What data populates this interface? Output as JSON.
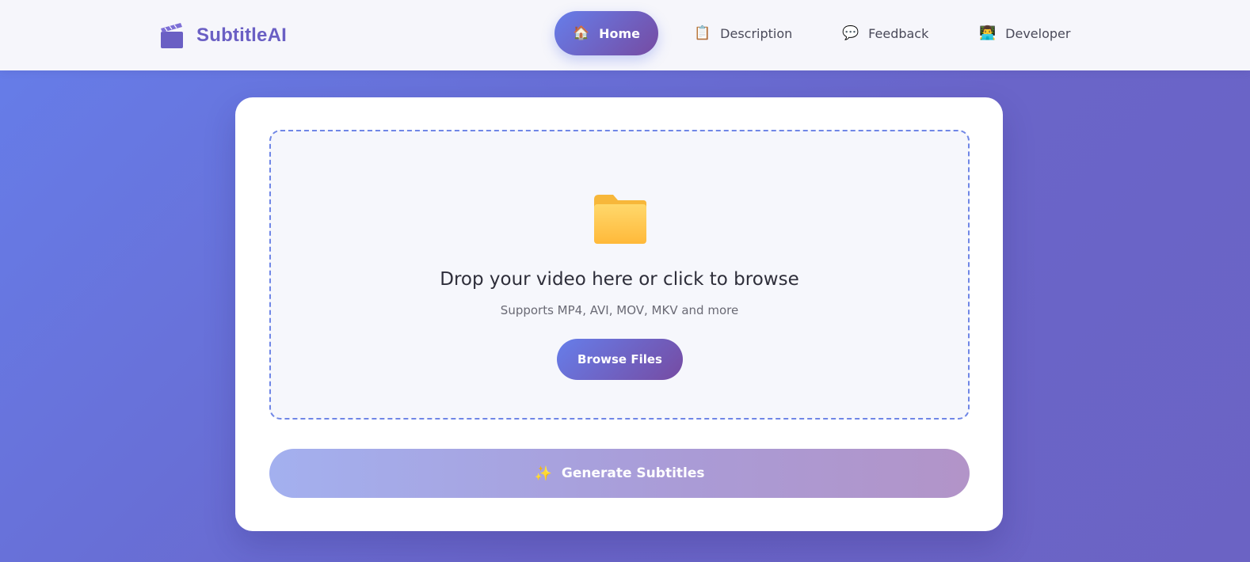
{
  "brand": {
    "name": "SubtitleAI",
    "icon": "clapperboard-icon"
  },
  "nav": {
    "items": [
      {
        "id": "home",
        "label": "Home",
        "icon": "house-icon",
        "glyph": "🏠",
        "active": true
      },
      {
        "id": "description",
        "label": "Description",
        "icon": "clipboard-icon",
        "glyph": "📋",
        "active": false
      },
      {
        "id": "feedback",
        "label": "Feedback",
        "icon": "speech-bubble-icon",
        "glyph": "💬",
        "active": false
      },
      {
        "id": "developer",
        "label": "Developer",
        "icon": "developer-icon",
        "glyph": "👨‍💻",
        "active": false
      }
    ]
  },
  "upload": {
    "icon": "folder-icon",
    "title": "Drop your video here or click to browse",
    "subtitle": "Supports MP4, AVI, MOV, MKV and more",
    "browse_label": "Browse Files"
  },
  "generate": {
    "label": "Generate Subtitles",
    "icon": "sparkles-icon",
    "glyph": "✨"
  },
  "colors": {
    "accent_start": "#667eea",
    "accent_end": "#764ba2",
    "brand_text": "#6a5fc4",
    "dropzone_border": "#6f86e6"
  }
}
